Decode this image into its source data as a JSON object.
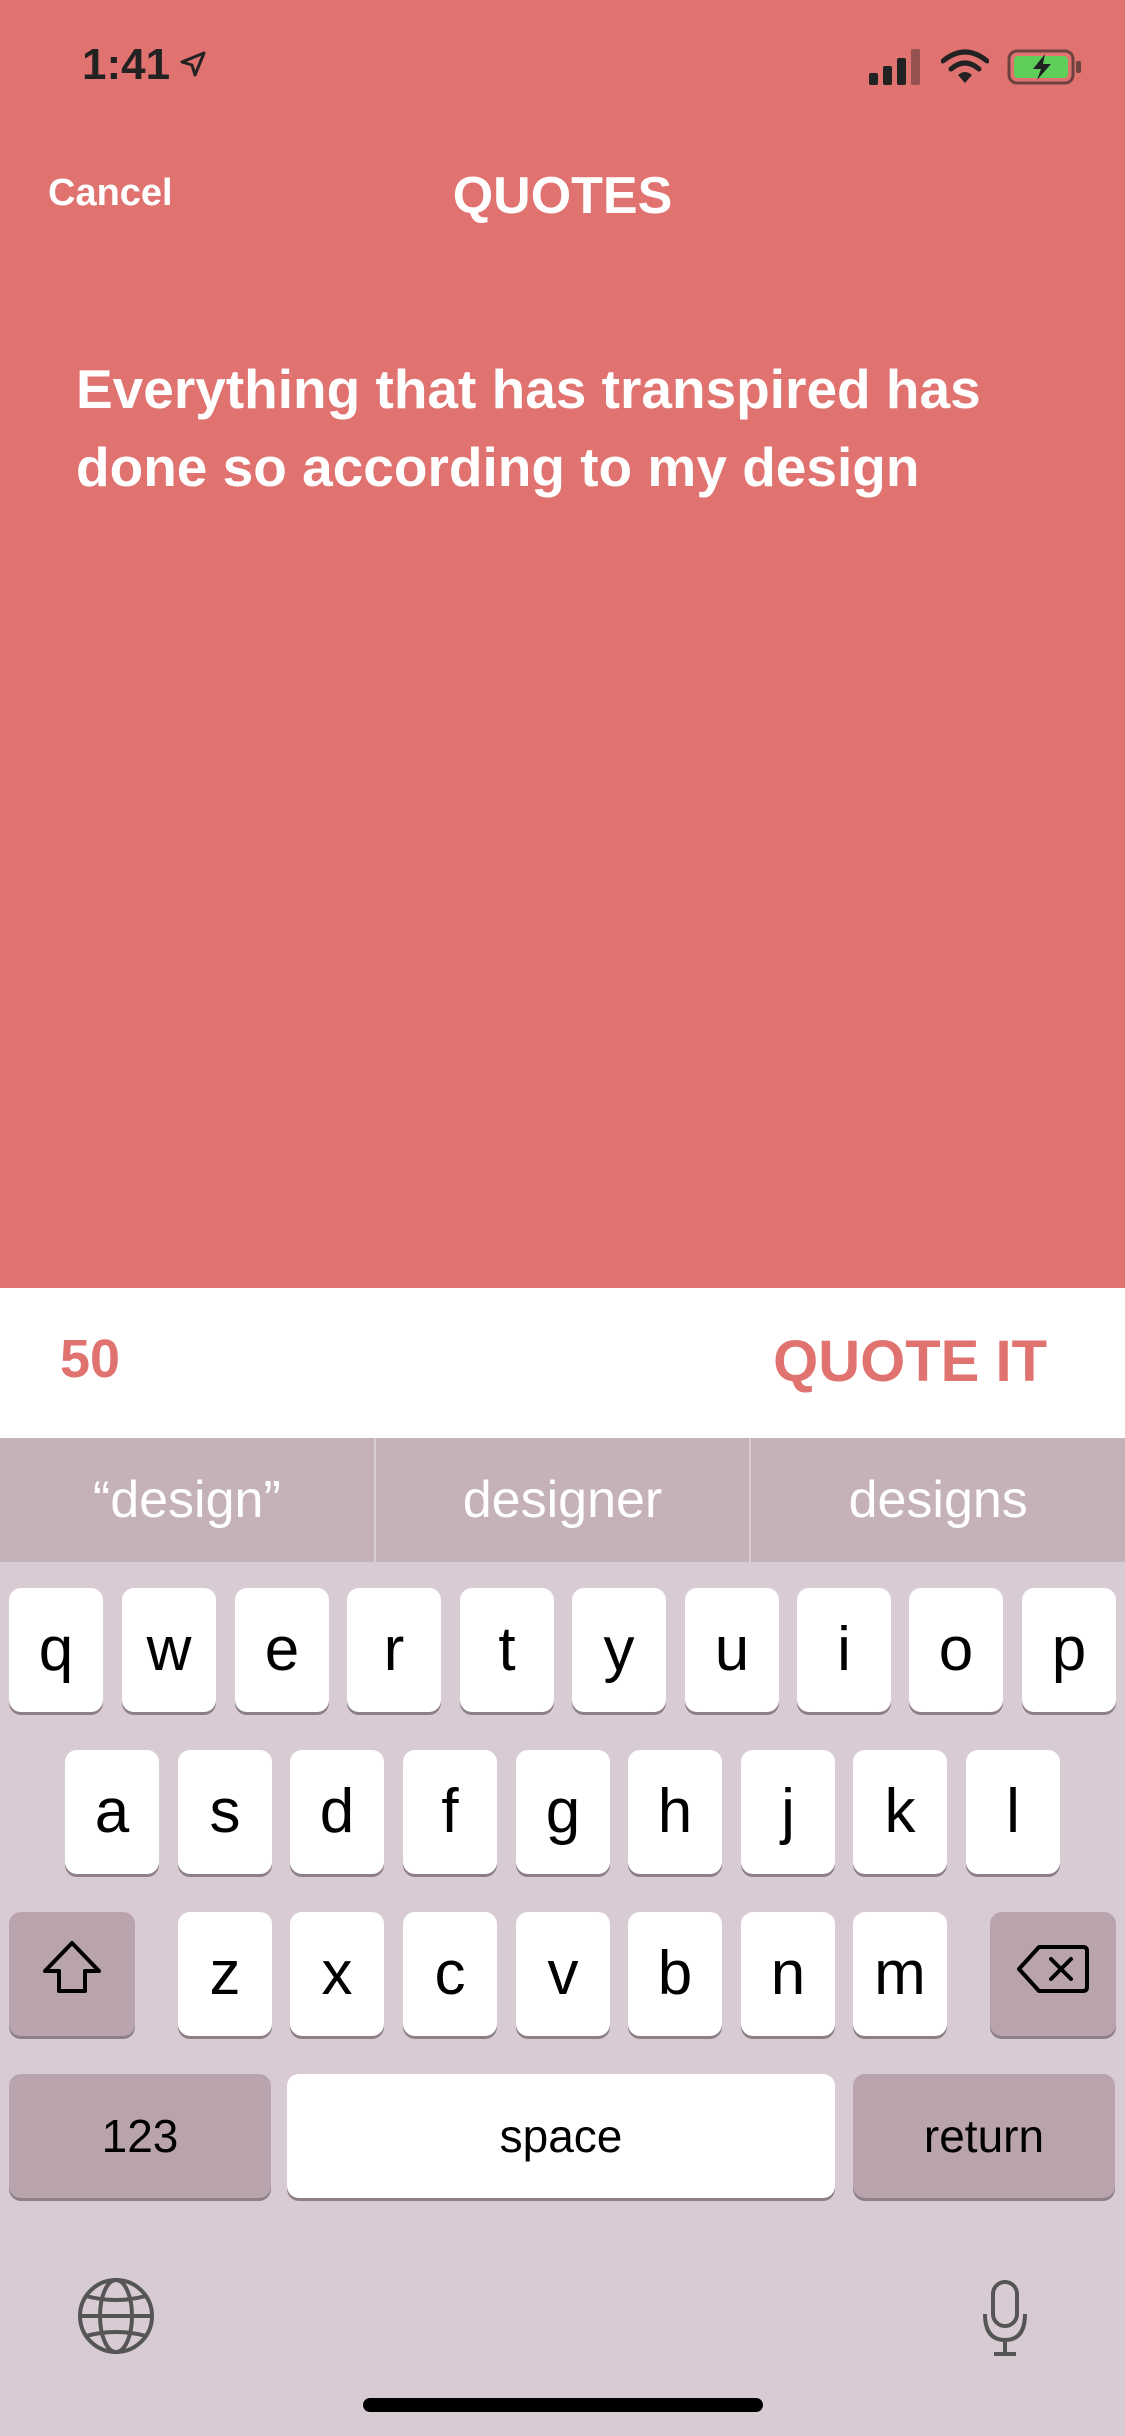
{
  "status_bar": {
    "time": "1:41"
  },
  "header": {
    "cancel_label": "Cancel",
    "title": "QUOTES"
  },
  "quote": {
    "text": "Everything that has transpired has done so according to my design"
  },
  "counter": {
    "remaining": "50",
    "quote_it_label": "QUOTE IT"
  },
  "keyboard": {
    "suggestions": [
      "“design”",
      "designer",
      "designs"
    ],
    "row1": [
      "q",
      "w",
      "e",
      "r",
      "t",
      "y",
      "u",
      "i",
      "o",
      "p"
    ],
    "row2": [
      "a",
      "s",
      "d",
      "f",
      "g",
      "h",
      "j",
      "k",
      "l"
    ],
    "row3": [
      "z",
      "x",
      "c",
      "v",
      "b",
      "n",
      "m"
    ],
    "numbers_label": "123",
    "space_label": "space",
    "return_label": "return"
  },
  "colors": {
    "accent": "#e07270",
    "white": "#ffffff"
  },
  "icons": [
    "location-arrow-icon",
    "signal-icon",
    "wifi-icon",
    "battery-icon",
    "shift-icon",
    "backspace-icon",
    "globe-icon",
    "microphone-icon"
  ]
}
